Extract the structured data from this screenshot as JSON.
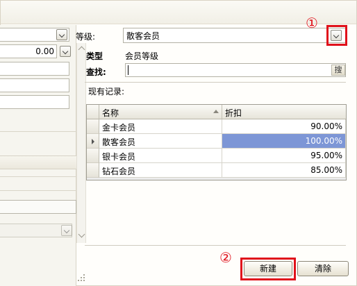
{
  "form": {
    "grade_label": "等级:",
    "grade_value": "散客会员",
    "type_label": "类型",
    "type_value": "会员等级",
    "find_label": "查找:",
    "find_value": "",
    "find_button": "搜",
    "records_label": "现有记录:"
  },
  "left_panel": {
    "amount_value": "0.00"
  },
  "grid": {
    "columns": [
      "名称",
      "折扣"
    ],
    "sort_column": "名称",
    "rows": [
      {
        "name": "金卡会员",
        "discount": "90.00%",
        "selected": false
      },
      {
        "name": "散客会员",
        "discount": "100.00%",
        "selected": true
      },
      {
        "name": "银卡会员",
        "discount": "95.00%",
        "selected": false
      },
      {
        "name": "钻石会员",
        "discount": "85.00%",
        "selected": false
      }
    ]
  },
  "buttons": {
    "new": "新建",
    "clear": "清除"
  },
  "annotations": {
    "marker_1": "①",
    "marker_2": "②",
    "highlight_color": "#e0111b"
  },
  "colors": {
    "selection": "#7d96d6"
  }
}
